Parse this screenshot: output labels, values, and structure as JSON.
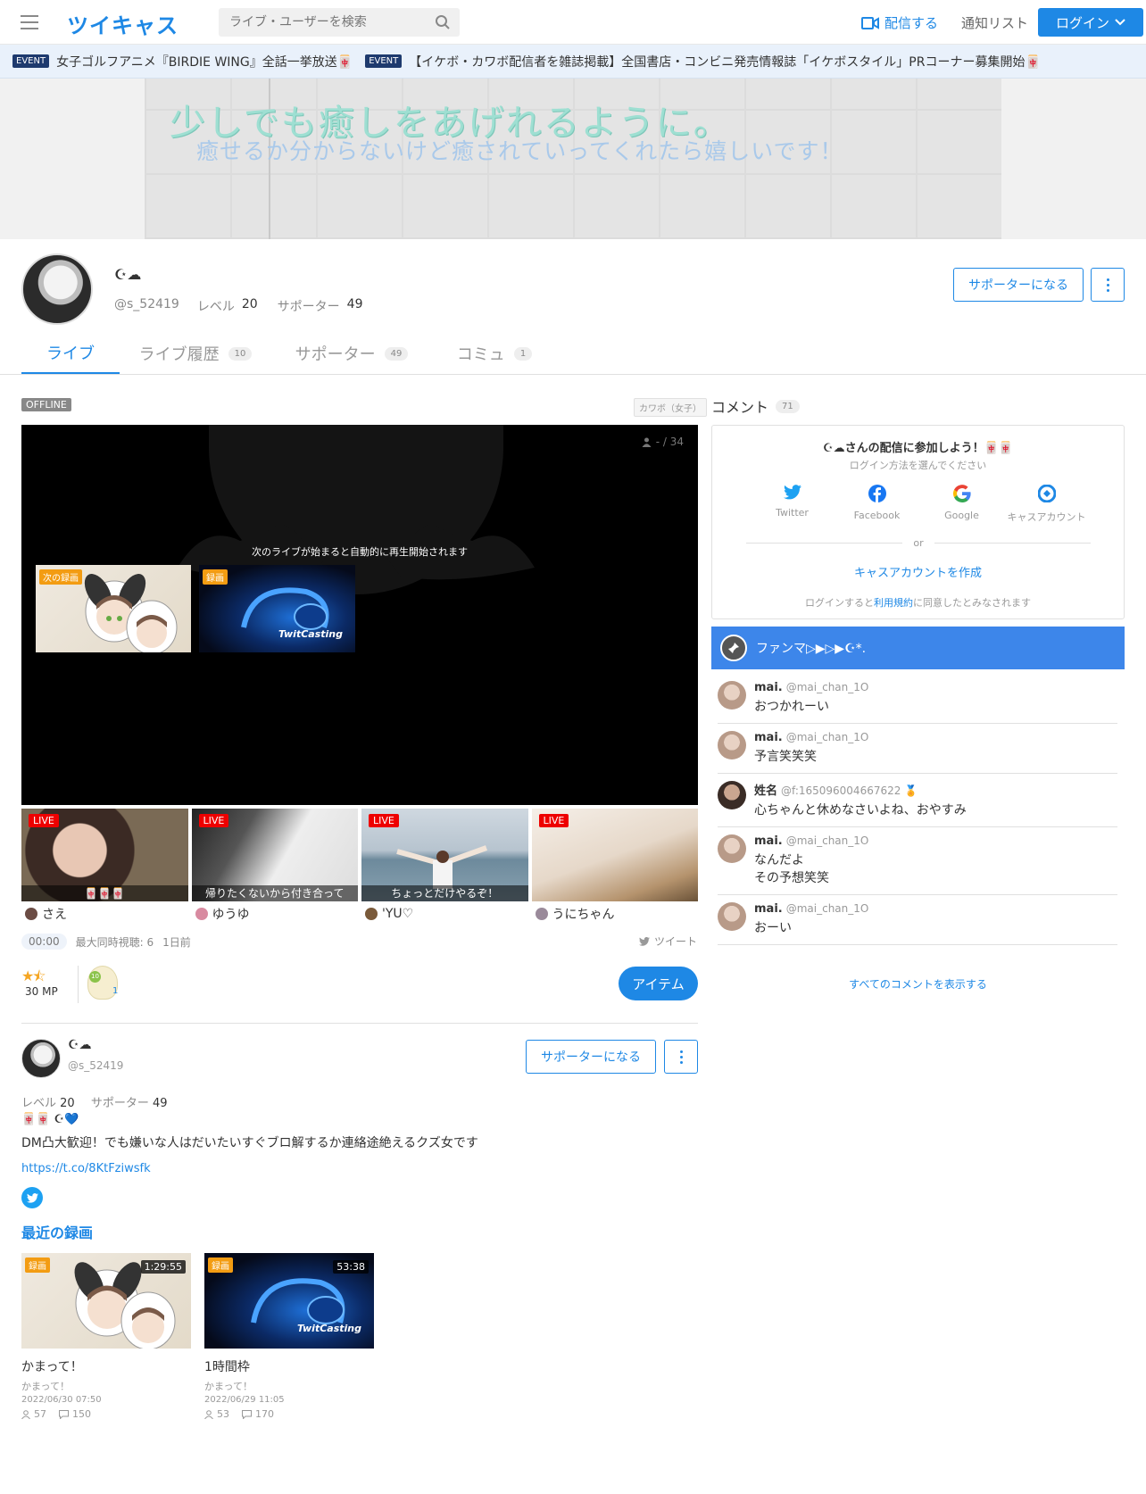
{
  "header": {
    "logo": "ツイキャス",
    "search_placeholder": "ライブ・ユーザーを検索",
    "broadcast_label": "配信する",
    "notify_label": "通知リスト",
    "login_label": "ログイン"
  },
  "events": [
    {
      "badge": "EVENT",
      "text": "女子ゴルフアニメ『BIRDIE WING』全話一挙放送🀄"
    },
    {
      "badge": "EVENT",
      "text": "【イケボ・カワボ配信者を雑誌掲載】全国書店・コンビニ発売情報誌「イケボスタイル」PRコーナー募集開始🀄"
    }
  ],
  "banner": {
    "line1": "少しでも癒しをあげれるように。",
    "line2": "癒せるか分からないけど癒されていってくれたら嬉しいです！"
  },
  "profile": {
    "name": "☪︎☁",
    "handle": "@s_52419",
    "level_label": "レベル",
    "level": "20",
    "supporter_label": "サポーター",
    "supporters": "49",
    "support_button": "サポーターになる"
  },
  "tabs": [
    {
      "label": "ライブ",
      "count": ""
    },
    {
      "label": "ライブ履歴",
      "count": "10"
    },
    {
      "label": "サポーター",
      "count": "49"
    },
    {
      "label": "コミュ",
      "count": "1"
    }
  ],
  "player": {
    "status": "OFFLINE",
    "category": "カワボ（女子）",
    "viewers": "- / 34",
    "message": "次のライブが始まると自動的に再生開始されます",
    "thumb1_label": "次の録画",
    "thumb2_label": "録画",
    "thumb2_brand": "TwitCasting"
  },
  "live_cards": [
    {
      "badge": "LIVE",
      "caption": "🀄🀄🀄",
      "name": "さえ"
    },
    {
      "badge": "LIVE",
      "caption": "帰りたくないから付き合って",
      "name": "ゆうゆ"
    },
    {
      "badge": "LIVE",
      "caption": "ちょっとだけやるぞ！",
      "name": "'YU♡"
    },
    {
      "badge": "LIVE",
      "caption": "",
      "name": "うにちゃん"
    }
  ],
  "stats": {
    "time": "00:00",
    "max_viewers": "最大同時視聴: 6",
    "ago": "1日前",
    "tweet_label": "ツイート",
    "mp": "30 MP",
    "medal_level": "10",
    "medal_count": "1",
    "item_button": "アイテム"
  },
  "bio": {
    "line1": "🀄🀄 ☪︎💙",
    "line2": "DM凸大歓迎！でも嫌いな人はだいたいすぐブロ解するか連絡途絶えるクズ女です",
    "link": "https://t.co/8KtFziwsfk"
  },
  "recent": {
    "title": "最近の録画",
    "items": [
      {
        "label": "録画",
        "duration": "1:29:55",
        "title": "かまって！",
        "sub": "かまって！",
        "date": "2022/06/30 07:50",
        "views": "57",
        "comments": "150"
      },
      {
        "label": "録画",
        "duration": "53:38",
        "title": "1時間枠",
        "sub": "かまって！",
        "date": "2022/06/29 11:05",
        "views": "53",
        "comments": "170"
      }
    ]
  },
  "comments_panel": {
    "title": "コメント",
    "count": "71",
    "login_title": "☪︎☁さんの配信に参加しよう！🀄🀄",
    "login_sub": "ログイン方法を選んでください",
    "sns": [
      "Twitter",
      "Facebook",
      "Google",
      "キャスアカウント"
    ],
    "or": "or",
    "create": "キャスアカウントを作成",
    "terms_pre": "ログインすると",
    "terms_link": "利用規約",
    "terms_post": "に同意したとみなされます",
    "pinned": "ファンマ▷▶▷▶☪︎*.",
    "all": "すべてのコメントを表示する"
  },
  "comments": [
    {
      "name": "mai.",
      "handle": "@mai_chan_1O",
      "text": "おつかれーい"
    },
    {
      "name": "mai.",
      "handle": "@mai_chan_1O",
      "text": "予言笑笑笑"
    },
    {
      "name": "姓名",
      "handle": "@f:165096004667622",
      "text": "心ちゃんと休めなさいよね、おやすみ"
    },
    {
      "name": "mai.",
      "handle": "@mai_chan_1O",
      "text": "なんだよ\nその予想笑笑"
    },
    {
      "name": "mai.",
      "handle": "@mai_chan_1O",
      "text": "おーい"
    }
  ],
  "colors": {
    "accent": "#1e88e5",
    "live": "#ee0000",
    "record": "#f39c12"
  }
}
